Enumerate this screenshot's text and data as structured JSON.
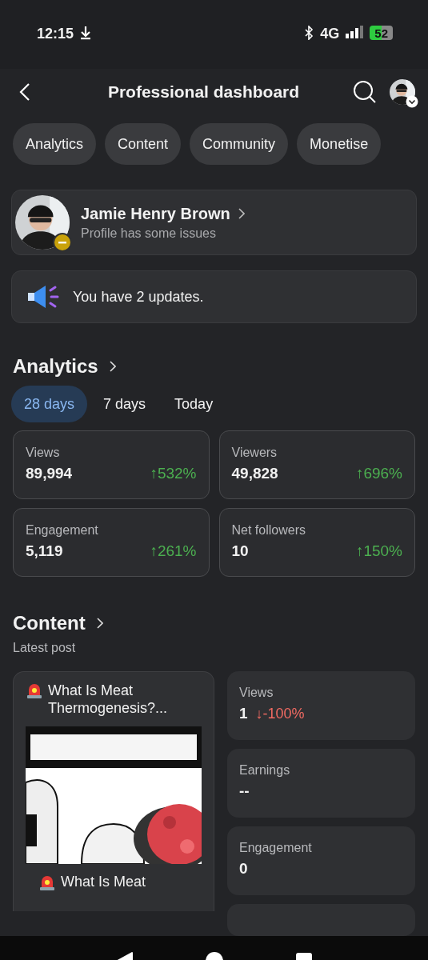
{
  "status_bar": {
    "time": "12:15",
    "network": "4G",
    "battery": "52"
  },
  "header": {
    "title": "Professional dashboard"
  },
  "chips": [
    {
      "label": "Analytics"
    },
    {
      "label": "Content"
    },
    {
      "label": "Community"
    },
    {
      "label": "Monetise"
    }
  ],
  "profile": {
    "name": "Jamie Henry Brown",
    "subtitle": "Profile has some issues"
  },
  "updates": {
    "text": "You have 2 updates."
  },
  "analytics": {
    "title": "Analytics",
    "ranges": [
      {
        "label": "28 days",
        "selected": true
      },
      {
        "label": "7 days",
        "selected": false
      },
      {
        "label": "Today",
        "selected": false
      }
    ],
    "stats": [
      {
        "label": "Views",
        "value": "89,994",
        "kind": "rise",
        "change": "↑532%"
      },
      {
        "label": "Viewers",
        "value": "49,828",
        "kind": "rise",
        "change": "↑696%"
      },
      {
        "label": "Engagement",
        "value": "5,119",
        "kind": "rise",
        "change": "↑261%"
      },
      {
        "label": "Net followers",
        "value": "10",
        "kind": "rise",
        "change": "↑150%"
      }
    ]
  },
  "content": {
    "title": "Content",
    "subtitle": "Latest post",
    "post": {
      "title": "What Is Meat Thermogenesis?...",
      "caption": "What Is Meat"
    },
    "stats": [
      {
        "label": "Views",
        "value": "1",
        "kind": "fall",
        "change": "↓-100%"
      },
      {
        "label": "Earnings",
        "value": "--"
      },
      {
        "label": "Engagement",
        "value": "0"
      }
    ]
  }
}
